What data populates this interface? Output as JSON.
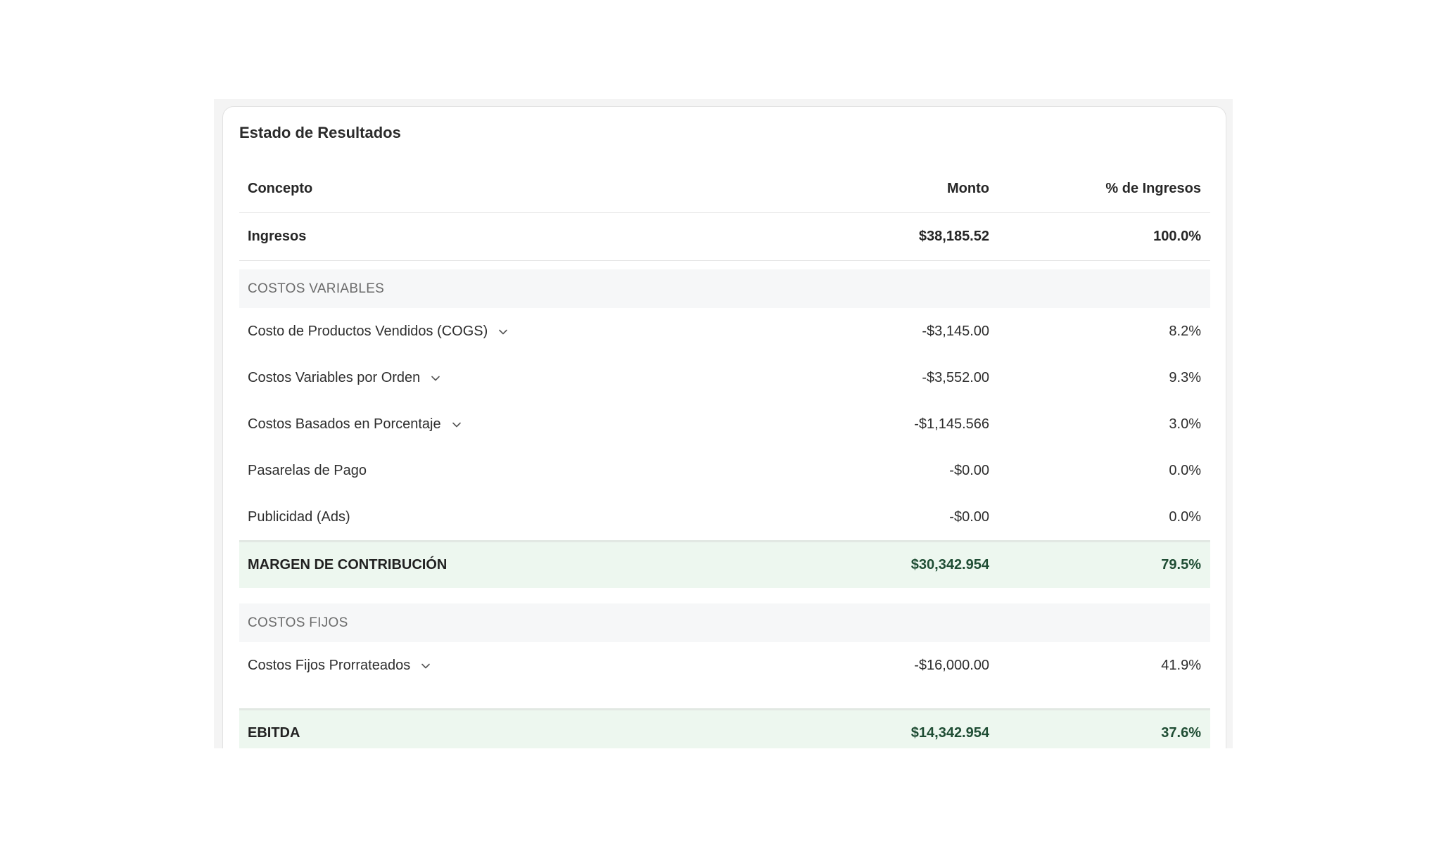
{
  "card": {
    "title": "Estado de Resultados"
  },
  "table": {
    "columns": [
      "Concepto",
      "Monto",
      "% de Ingresos"
    ],
    "ingresos": {
      "label": "Ingresos",
      "monto": "$38,185.52",
      "pct": "100.0%"
    },
    "costos_variables": {
      "section_label": "COSTOS VARIABLES",
      "items": [
        {
          "label": "Costo de Productos Vendidos (COGS)",
          "monto": "-$3,145.00",
          "pct": "8.2%",
          "expandable": true
        },
        {
          "label": "Costos Variables por Orden",
          "monto": "-$3,552.00",
          "pct": "9.3%",
          "expandable": true
        },
        {
          "label": "Costos Basados en Porcentaje",
          "monto": "-$1,145.566",
          "pct": "3.0%",
          "expandable": true
        },
        {
          "label": "Pasarelas de Pago",
          "monto": "-$0.00",
          "pct": "0.0%",
          "expandable": false
        },
        {
          "label": "Publicidad (Ads)",
          "monto": "-$0.00",
          "pct": "0.0%",
          "expandable": false
        }
      ]
    },
    "margen": {
      "label": "MARGEN DE CONTRIBUCIÓN",
      "monto": "$30,342.954",
      "pct": "79.5%"
    },
    "costos_fijos": {
      "section_label": "COSTOS FIJOS",
      "items": [
        {
          "label": "Costos Fijos Prorrateados",
          "monto": "-$16,000.00",
          "pct": "41.9%",
          "expandable": true
        }
      ]
    },
    "ebitda": {
      "label": "EBITDA",
      "monto": "$14,342.954",
      "pct": "37.6%"
    }
  },
  "icons": {
    "expand": "chevron-down-icon"
  },
  "colors": {
    "total_text": "#1f4d34",
    "total_bg": "#edf7ef",
    "section_bg": "#f6f7f8"
  }
}
